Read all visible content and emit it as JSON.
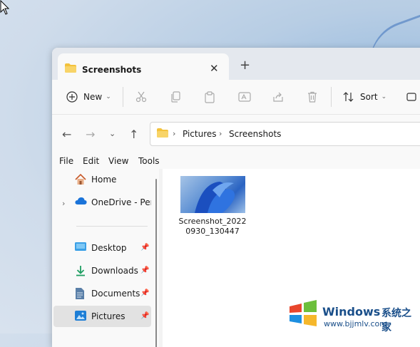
{
  "tab": {
    "title": "Screenshots",
    "close": "✕",
    "new_tab": "+"
  },
  "toolbar": {
    "new_label": "New",
    "sort_label": "Sort"
  },
  "breadcrumb": [
    "Pictures",
    "Screenshots"
  ],
  "menu": [
    "File",
    "Edit",
    "View",
    "Tools"
  ],
  "sidebar": {
    "items": [
      {
        "label": "Home",
        "icon": "home-icon",
        "pinned": false
      },
      {
        "label": "OneDrive - Perso",
        "icon": "cloud-icon",
        "pinned": false
      },
      {
        "label": "Desktop",
        "icon": "desktop-icon",
        "pinned": true
      },
      {
        "label": "Downloads",
        "icon": "download-icon",
        "pinned": true
      },
      {
        "label": "Documents",
        "icon": "document-icon",
        "pinned": true
      },
      {
        "label": "Pictures",
        "icon": "pictures-icon",
        "pinned": true
      }
    ]
  },
  "files": [
    {
      "name_line1": "Screenshot_2022",
      "name_line2": "0930_130447"
    }
  ],
  "watermark": {
    "brand": "Windows",
    "cn": "系统之家",
    "url": "www.bjjmlv.com"
  },
  "colors": {
    "accent": "#0067c0",
    "selected": "#e2e2e2",
    "folder": "#f3c23c"
  }
}
